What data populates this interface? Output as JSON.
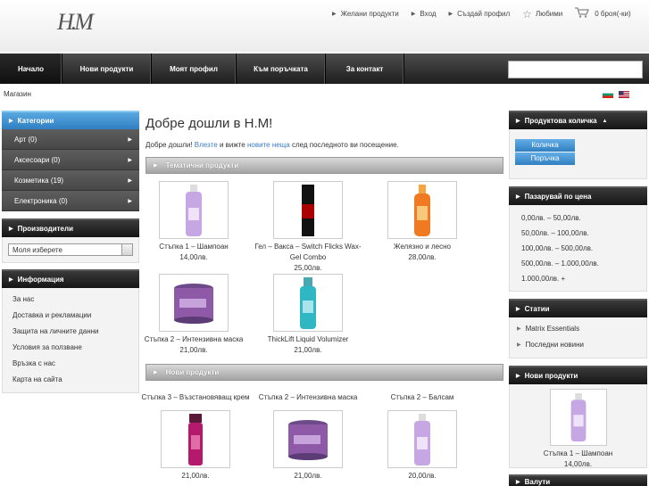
{
  "header": {
    "logo_text": "Н.М",
    "links": [
      {
        "label": "Желани продукти"
      },
      {
        "label": "Вход"
      },
      {
        "label": "Създай профил"
      }
    ],
    "favorites": "Любими",
    "cart_count": "0 броя(-ки)"
  },
  "nav": {
    "items": [
      {
        "label": "Начало"
      },
      {
        "label": "Нови продукти"
      },
      {
        "label": "Моят профил"
      },
      {
        "label": "Към поръчката"
      },
      {
        "label": "За контакт"
      }
    ],
    "search_placeholder": ""
  },
  "breadcrumb": "Магазин",
  "left": {
    "categories_title": "Категории",
    "categories": [
      {
        "label": "Арт (0)"
      },
      {
        "label": "Аксесоари (0)"
      },
      {
        "label": "Козметика (19)"
      },
      {
        "label": "Електроника (0)"
      }
    ],
    "manufacturers_title": "Производители",
    "manufacturer_select": "Моля изберете",
    "info_title": "Информация",
    "info_links": [
      {
        "label": "За нас"
      },
      {
        "label": "Доставка и рекламации"
      },
      {
        "label": "Защита на личните данни"
      },
      {
        "label": "Условия за ползване"
      },
      {
        "label": "Връзка с нас"
      },
      {
        "label": "Карта на сайта"
      }
    ]
  },
  "main": {
    "title": "Добре дошли в Н.М!",
    "welcome_a": "Добре дошли! ",
    "welcome_link1": "Влезте",
    "welcome_b": " и вижте ",
    "welcome_link2": "новите неща",
    "welcome_c": " след последното ви посещение.",
    "featured_title": "Тематични продукти",
    "featured": [
      {
        "name": "Стъпка 1 – Шампоан",
        "price": "14,00лв."
      },
      {
        "name": "Гел – Вакса – Switch Flicks Wax-Gel Combo",
        "price": "25,00лв."
      },
      {
        "name": "Желязно и лесно",
        "price": "28,00лв."
      },
      {
        "name": "Стъпка 2 – Интензивна маска",
        "price": "21,00лв."
      },
      {
        "name": "ThickLift Liquid Volumizer",
        "price": "21,00лв."
      }
    ],
    "new_title": "Нови продукти",
    "new_products": [
      {
        "name": "Стъпка 3 – Възстановяващ крем",
        "price": "21,00лв."
      },
      {
        "name": "Стъпка 2 – Интензивна маска",
        "price": "21,00лв."
      },
      {
        "name": "Стъпка 2 – Балсам",
        "price": "20,00лв."
      }
    ]
  },
  "right": {
    "cart_title": "Продуктова количка",
    "cart_buttons": [
      {
        "label": "Количка"
      },
      {
        "label": "Поръчка"
      }
    ],
    "price_title": "Пазарувай по цена",
    "price_ranges": [
      {
        "label": "0,00лв. – 50,00лв."
      },
      {
        "label": "50,00лв. – 100,00лв."
      },
      {
        "label": "100,00лв. – 500,00лв."
      },
      {
        "label": "500,00лв. – 1.000,00лв."
      },
      {
        "label": "1.000,00лв. +"
      }
    ],
    "articles_title": "Статии",
    "articles": [
      {
        "label": "Matrix Essentials"
      },
      {
        "label": "Последни новини"
      }
    ],
    "new_title": "Нови продукти",
    "new_product": {
      "name": "Стъпка 1 – Шампоан",
      "price": "14,00лв."
    },
    "bottom_title": "Валути"
  }
}
